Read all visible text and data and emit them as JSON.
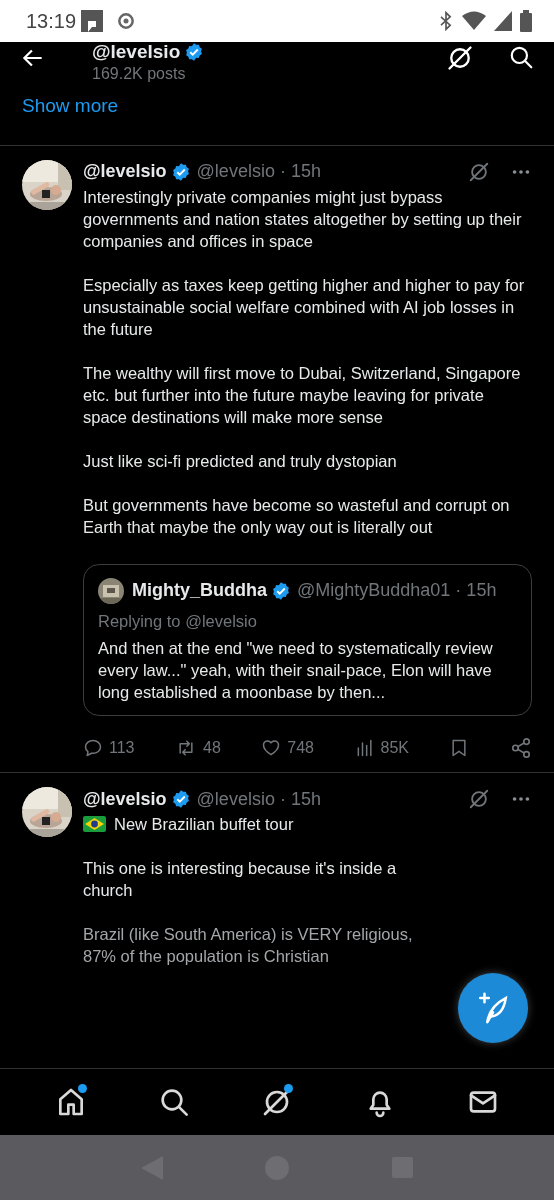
{
  "status_bar": {
    "time": "13:19"
  },
  "header": {
    "title": "@levelsio",
    "verified": true,
    "posts": "169.2K posts"
  },
  "show_more": "Show more",
  "tweets": [
    {
      "name": "@levelsio",
      "verified": true,
      "meta": "@levelsio · 15h",
      "paragraphs": [
        {
          "kind": "text",
          "text": "Interestingly private companies might just bypass governments and nation states altogether by setting up their companies and offices in space"
        },
        {
          "kind": "text",
          "text": "Especially as taxes keep getting higher and higher to pay for unsustainable social welfare combined with AI job losses in the future"
        },
        {
          "kind": "text",
          "text": "The wealthy will first move to Dubai, Switzerland, Singapore etc. but further into the future maybe leaving for private space destinations will make more sense"
        },
        {
          "kind": "text",
          "text": "Just like sci-fi predicted and truly dystopian"
        },
        {
          "kind": "text",
          "text": "But governments have become so wasteful and corrupt on Earth that maybe the only way out is literally out"
        }
      ],
      "quote": {
        "name": "Mighty_Buddha",
        "verified": true,
        "meta": "@MightyBuddha01 · 15h",
        "replying": "Replying to @levelsio",
        "text": "And then at the end \"we need to systematically review every law...\" yeah, with their snail-pace, Elon will have long established a moonbase by then..."
      },
      "stats": {
        "replies": "113",
        "reposts": "48",
        "likes": "748",
        "views": "85K"
      }
    },
    {
      "name": "@levelsio",
      "verified": true,
      "meta": "@levelsio · 15h",
      "paragraphs": [
        {
          "kind": "flag",
          "text": "New Brazilian buffet tour"
        },
        {
          "kind": "text",
          "text": "This one is interesting because it's inside a church"
        },
        {
          "kind": "faded",
          "text": "Brazil (like South America) is VERY religious, 87% of the population is Christian"
        }
      ]
    }
  ],
  "nav": [
    {
      "kind": "home",
      "badge": true
    },
    {
      "kind": "search",
      "badge": false
    },
    {
      "kind": "grok",
      "badge": true
    },
    {
      "kind": "bell",
      "badge": false
    },
    {
      "kind": "mail",
      "badge": false
    }
  ]
}
